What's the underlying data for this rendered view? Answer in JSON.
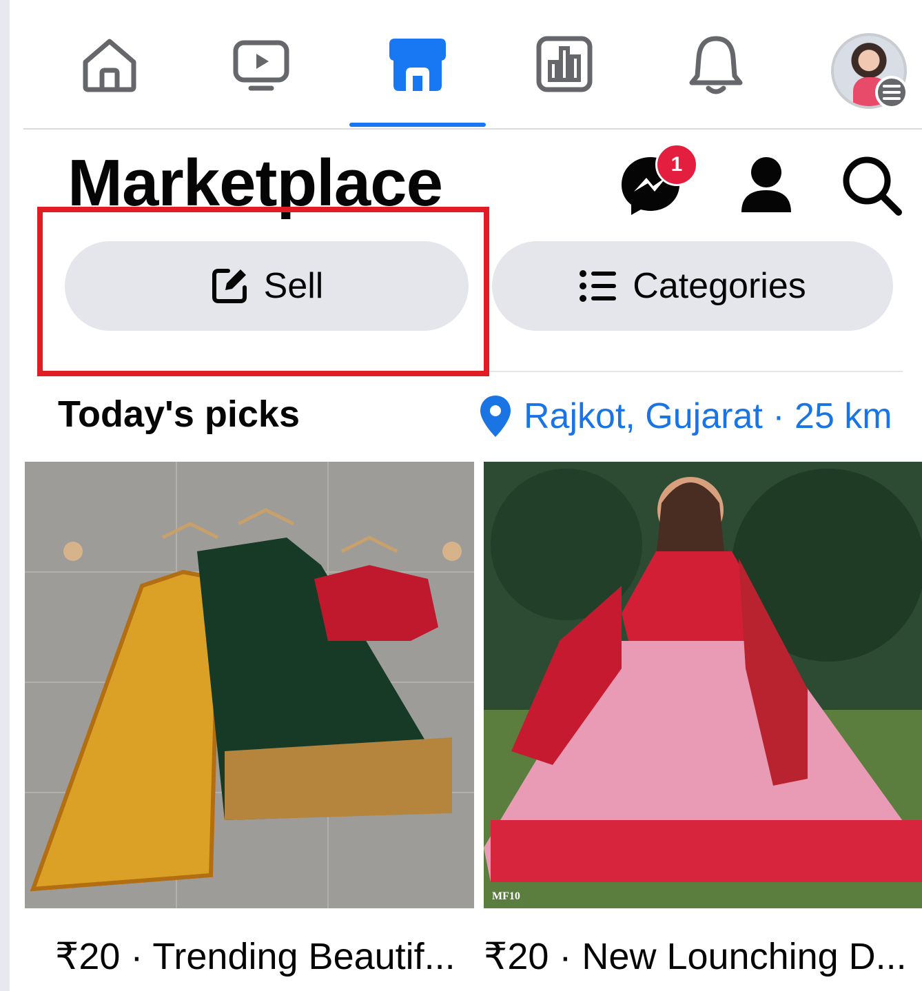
{
  "nav": {
    "tabs": [
      {
        "name": "home",
        "icon": "home-icon"
      },
      {
        "name": "watch",
        "icon": "video-icon"
      },
      {
        "name": "marketplace",
        "icon": "marketplace-icon",
        "active": true
      },
      {
        "name": "dashboard",
        "icon": "dashboard-icon"
      },
      {
        "name": "notifications",
        "icon": "bell-icon"
      },
      {
        "name": "profile",
        "icon": "avatar"
      }
    ]
  },
  "header": {
    "title": "Marketplace",
    "messenger_badge": "1"
  },
  "actions": {
    "sell_label": "Sell",
    "categories_label": "Categories"
  },
  "picks": {
    "title": "Today's picks",
    "location": "Rajkot, Gujarat · 25 km"
  },
  "listings": [
    {
      "caption": "₹20 · Trending Beautif..."
    },
    {
      "caption": "₹20 · New Lounching D...",
      "image_watermark": "MF10"
    }
  ],
  "colors": {
    "accent": "#1877f2",
    "highlight": "#e01c24",
    "badge": "#e41e3f"
  }
}
